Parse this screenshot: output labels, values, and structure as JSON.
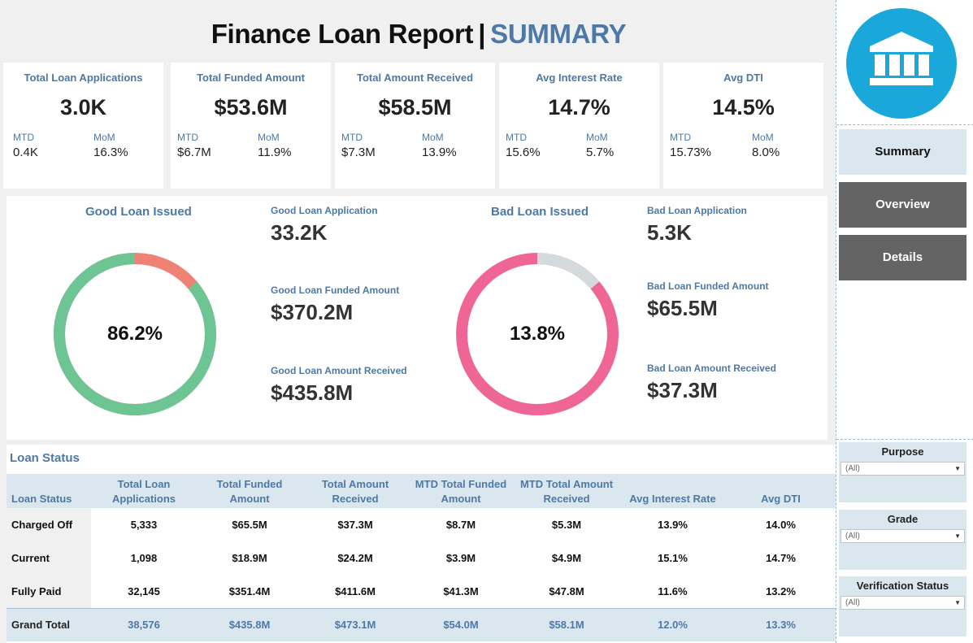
{
  "header": {
    "title_main": "Finance Loan Report",
    "separator": "|",
    "title_accent": "SUMMARY"
  },
  "kpis": [
    {
      "label": "Total Loan Applications",
      "value": "3.0K",
      "mtd_label": "MTD",
      "mtd": "0.4K",
      "mom_label": "MoM",
      "mom": "16.3%"
    },
    {
      "label": "Total Funded Amount",
      "value": "$53.6M",
      "mtd_label": "MTD",
      "mtd": "$6.7M",
      "mom_label": "MoM",
      "mom": "11.9%"
    },
    {
      "label": "Total Amount Received",
      "value": "$58.5M",
      "mtd_label": "MTD",
      "mtd": "$7.3M",
      "mom_label": "MoM",
      "mom": "13.9%"
    },
    {
      "label": "Avg Interest Rate",
      "value": "14.7%",
      "mtd_label": "MTD",
      "mtd": "15.6%",
      "mom_label": "MoM",
      "mom": "5.7%"
    },
    {
      "label": "Avg DTI",
      "value": "14.5%",
      "mtd_label": "MTD",
      "mtd": "15.73%",
      "mom_label": "MoM",
      "mom": "8.0%"
    }
  ],
  "good_loan": {
    "title": "Good Loan Issued",
    "percent_label": "86.2%",
    "percent": 86.2,
    "color_main": "#6cc592",
    "color_rest": "#ef8275",
    "application_label": "Good Loan Application",
    "application": "33.2K",
    "funded_label": "Good Loan Funded Amount",
    "funded": "$370.2M",
    "received_label": "Good Loan Amount Received",
    "received": "$435.8M"
  },
  "bad_loan": {
    "title": "Bad Loan Issued",
    "percent_label": "13.8%",
    "percent": 13.8,
    "color_main": "#d5dadc",
    "color_rest": "#ef6595",
    "application_label": "Bad Loan Application",
    "application": "5.3K",
    "funded_label": "Bad Loan Funded Amount",
    "funded": "$65.5M",
    "received_label": "Bad Loan Amount Received",
    "received": "$37.3M"
  },
  "loan_status": {
    "title": "Loan Status",
    "columns": [
      "Loan Status",
      "Total Loan Applications",
      "Total Funded Amount",
      "Total Amount Received",
      "MTD Total Funded Amount",
      "MTD Total Amount Received",
      "Avg Interest Rate",
      "Avg DTI"
    ],
    "rows": [
      [
        "Charged Off",
        "5,333",
        "$65.5M",
        "$37.3M",
        "$8.7M",
        "$5.3M",
        "13.9%",
        "14.0%"
      ],
      [
        "Current",
        "1,098",
        "$18.9M",
        "$24.2M",
        "$3.9M",
        "$4.9M",
        "15.1%",
        "14.7%"
      ],
      [
        "Fully Paid",
        "32,145",
        "$351.4M",
        "$411.6M",
        "$41.3M",
        "$47.8M",
        "11.6%",
        "13.2%"
      ]
    ],
    "total": [
      "Grand Total",
      "38,576",
      "$435.8M",
      "$473.1M",
      "$54.0M",
      "$58.1M",
      "12.0%",
      "13.3%"
    ]
  },
  "nav": {
    "logo_icon": "bank-icon",
    "summary": "Summary",
    "overview": "Overview",
    "details": "Details"
  },
  "filters": [
    {
      "title": "Purpose",
      "value": "(All)"
    },
    {
      "title": "Grade",
      "value": "(All)"
    },
    {
      "title": "Verification Status",
      "value": "(All)"
    }
  ]
}
